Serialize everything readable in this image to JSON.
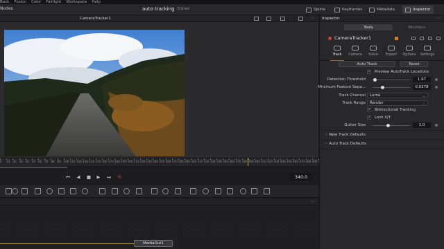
{
  "menubar": {
    "items": [
      "Back",
      "Fusion",
      "Color",
      "Fairlight",
      "Workspace",
      "Help"
    ]
  },
  "topbar": {
    "panel_label": "Nodes",
    "project_title": "auto tracking",
    "status": "Edited",
    "buttons": {
      "spline": "Spline",
      "keyframes": "Keyframes",
      "metadata": "Metadata",
      "inspector": "Inspector"
    }
  },
  "viewer": {
    "title": "CameraTracker1",
    "ruler_ticks": [
      "0",
      "10",
      "20",
      "30",
      "40",
      "50",
      "60",
      "70",
      "80",
      "90",
      "100",
      "110",
      "120",
      "130",
      "140",
      "150",
      "160",
      "170",
      "180",
      "190",
      "200",
      "210",
      "220",
      "230",
      "240",
      "250",
      "260",
      "270",
      "280",
      "290",
      "300",
      "310",
      "320",
      "330",
      "340",
      "350",
      "360",
      "370",
      "380",
      "390",
      "400",
      "410",
      "420",
      "430",
      "440",
      "450",
      "460",
      "470",
      "480",
      "490",
      "500"
    ],
    "current_frame": "340.0"
  },
  "node_editor": {
    "media_out_label": "MediaOut1"
  },
  "inspector": {
    "title": "Inspector",
    "tabs": [
      "Tools",
      "Modifiers"
    ],
    "tool_name": "CameraTracker1",
    "subtabs": [
      "Track",
      "Camera",
      "Solve",
      "Export",
      "Options",
      "Settings"
    ],
    "auto_track_button": "Auto Track",
    "reset_button": "Reset",
    "preview_label": "Preview AutoTrack Locations",
    "detection_threshold_label": "Detection Threshold",
    "detection_threshold_value": "1.97",
    "min_feature_label": "Minimum Feature Sepa...",
    "min_feature_value": "0.0378",
    "track_channel_label": "Track Channel",
    "track_channel_value": "Luma",
    "track_range_label": "Track Range",
    "track_range_value": "Render",
    "bidirectional_label": "Bidirectional Tracking",
    "lock_xy_label": "Lock X/Y",
    "gutter_size_label": "Gutter Size",
    "gutter_size_value": "1.0",
    "sections": [
      "New Track Defaults",
      "Auto Track Defaults"
    ]
  },
  "colors": {
    "accent_red": "#d0473a",
    "playhead": "#d6a640",
    "node_wire": "#d4b24a"
  }
}
